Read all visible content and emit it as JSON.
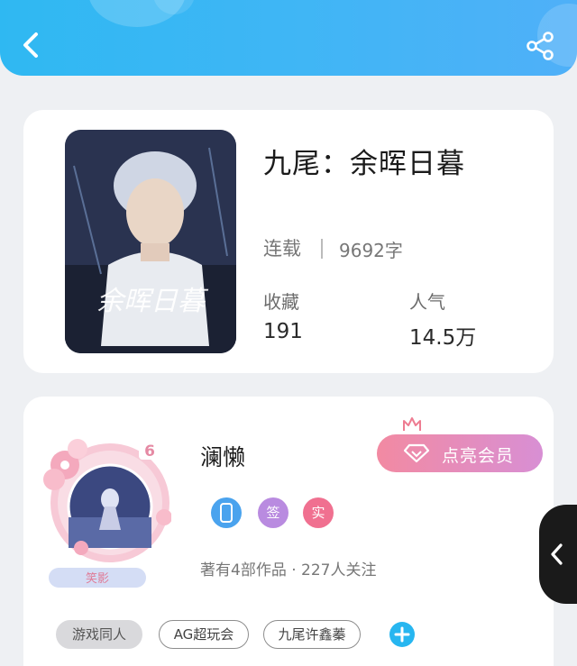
{
  "book": {
    "title": "九尾：余晖日暮",
    "status": "连载",
    "word_count": "9692字",
    "collect_label": "收藏",
    "collect_value": "191",
    "popularity_label": "人气",
    "popularity_value": "14.5万",
    "cover_title": "余晖日暮"
  },
  "author": {
    "name": "澜懒",
    "level": "6",
    "avatar_caption": "笑影",
    "vip_button": "点亮会员",
    "badges": [
      "签",
      "实"
    ],
    "meta": "著有4部作品 · 227人关注",
    "tags": [
      "游戏同人",
      "AG超玩会",
      "九尾许鑫蓁"
    ]
  },
  "colors": {
    "header": "#2fb8f2",
    "accent_blue": "#27b6f0",
    "vip_pink": "#f28aa2",
    "badge_purple": "#b98be0",
    "badge_pink": "#f07090"
  },
  "icons": {
    "back": "chevron-left-icon",
    "share": "share-icon",
    "vip": "diamond-icon",
    "crown": "crown-icon",
    "add": "plus-icon",
    "side": "chevron-left-icon"
  }
}
